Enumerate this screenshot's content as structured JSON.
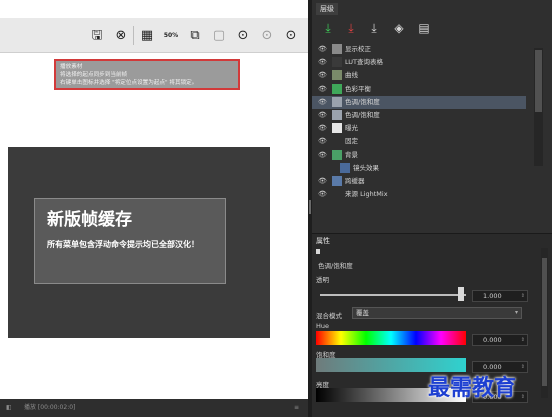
{
  "toolbar": {
    "buttons": [
      {
        "name": "save-icon",
        "glyph": "🖫"
      },
      {
        "name": "cancel-icon",
        "glyph": "⊗"
      },
      {
        "name": "grid-icon",
        "glyph": "▦"
      },
      {
        "name": "zoom-icon",
        "glyph": "50%"
      },
      {
        "name": "copy-icon",
        "glyph": "⧉"
      },
      {
        "name": "paste-icon",
        "glyph": "▢"
      },
      {
        "name": "camera-icon",
        "glyph": "⊙"
      },
      {
        "name": "camera-dim-icon",
        "glyph": "⊙"
      },
      {
        "name": "camera-alt-icon",
        "glyph": "⊙"
      }
    ],
    "zoom_label": "50%"
  },
  "tooltip": {
    "line1": "播放素材",
    "line2": "将选择的起点同步到当前帧",
    "line3": "右键单击图标并选择 \"将定位点设置为起点\" 将其锁定。"
  },
  "preview": {
    "title": "新版帧缓存",
    "description": "所有菜单包含浮动命令提示均已全部汉化！"
  },
  "timebar": {
    "label": "播放 [00:00:02:0]",
    "left_glyph": "◧"
  },
  "layers_panel": {
    "tab": "层级",
    "tools": [
      "add-layer-icon",
      "delete-layer-icon",
      "merge-layer-icon",
      "layers-icon",
      "document-icon"
    ],
    "items": [
      {
        "name": "显示校正",
        "thumb": "#8a8a8a",
        "visible": true,
        "indent": 0
      },
      {
        "name": "LUT查询表格",
        "thumb": "#3a3a3a",
        "visible": true,
        "indent": 0
      },
      {
        "name": "曲线",
        "thumb": "#7a8a6a",
        "visible": true,
        "indent": 0
      },
      {
        "name": "色彩平衡",
        "thumb": "#3fa85a",
        "visible": true,
        "indent": 0
      },
      {
        "name": "色调/饱和度",
        "thumb": "#9aa2ad",
        "visible": true,
        "indent": 0,
        "selected": true
      },
      {
        "name": "色调/饱和度",
        "thumb": "#9aa2ad",
        "visible": true,
        "indent": 0
      },
      {
        "name": "曝光",
        "thumb": "#e6e6e6",
        "visible": true,
        "indent": 0
      },
      {
        "name": "固定",
        "thumb": "#2f2f2f",
        "visible": true,
        "indent": 0
      },
      {
        "name": "背景",
        "thumb": "#4aa067",
        "visible": true,
        "indent": 0
      },
      {
        "name": "镜头效果",
        "thumb": "#4a6a9a",
        "visible": false,
        "indent": 1
      },
      {
        "name": "跨缓器",
        "thumb": "#5a7aa8",
        "visible": true,
        "indent": 0
      },
      {
        "name": "来源 LightMix",
        "thumb": "#2f2f2f",
        "visible": true,
        "indent": 0
      }
    ]
  },
  "properties": {
    "header": "属性",
    "layer_name": "色调/饱和度",
    "opacity_label": "透明",
    "opacity_value": "1.000",
    "opacity_fraction": 1.0,
    "blend_label": "混合模式",
    "blend_value": "覆盖",
    "hue_label": "Hue",
    "hue_value": "0.000",
    "saturation_label": "饱和度",
    "saturation_value": "0.000",
    "lightness_label": "亮度",
    "lightness_value": "0.000"
  },
  "watermark": "最需教育"
}
